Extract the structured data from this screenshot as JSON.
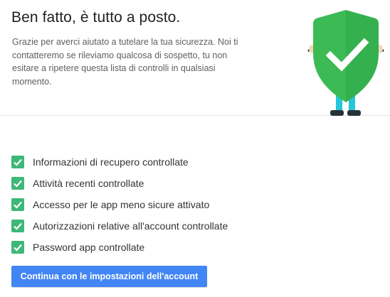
{
  "header": {
    "title": "Ben fatto, è tutto a posto.",
    "description": "Grazie per averci aiutato a tutelare la tua sicurezza. Noi ti contatteremo se rileviamo qualcosa di sospetto, tu non esitare a ripetere questa lista di controlli in qualsiasi momento.",
    "illustration_icon": "shield-checkmark"
  },
  "checklist": {
    "items": [
      {
        "label": "Informazioni di recupero controllate",
        "checked": true
      },
      {
        "label": "Attività recenti controllate",
        "checked": true
      },
      {
        "label": "Accesso per le app meno sicure attivato",
        "checked": true
      },
      {
        "label": "Autorizzazioni relative all'account controllate",
        "checked": true
      },
      {
        "label": "Password app controllate",
        "checked": true
      }
    ]
  },
  "actions": {
    "continue_label": "Continua con le impostazioni dell'account"
  },
  "colors": {
    "accent_blue": "#4285f4",
    "check_green": "#3cb878",
    "shield_green": "#3cba54",
    "shield_dark_green": "#2a9c48",
    "legs_cyan": "#26c6da"
  }
}
